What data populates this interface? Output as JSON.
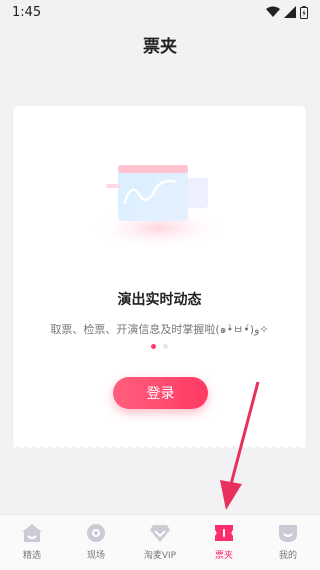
{
  "status_bar": {
    "time": "1:45"
  },
  "header": {
    "title": "票夹"
  },
  "empty_state": {
    "title": "演出实时动态",
    "description": "取票、检票、开演信息及时掌握啦(๑•̀ㅂ•́)و✧",
    "pager": {
      "total": 2,
      "active_index": 0
    },
    "login_label": "登录"
  },
  "tabs": [
    {
      "label": "精选",
      "icon": "home-icon"
    },
    {
      "label": "现场",
      "icon": "eye-icon"
    },
    {
      "label": "淘麦VIP",
      "icon": "diamond-icon"
    },
    {
      "label": "票夹",
      "icon": "ticket-icon",
      "active": true
    },
    {
      "label": "我的",
      "icon": "profile-icon"
    }
  ],
  "colors": {
    "accent": "#ff2d6b",
    "button_start": "#ff5f7f",
    "button_end": "#ff3a64",
    "arrow": "#e8305c",
    "tab_icon_inactive": "#c9ccd4"
  }
}
